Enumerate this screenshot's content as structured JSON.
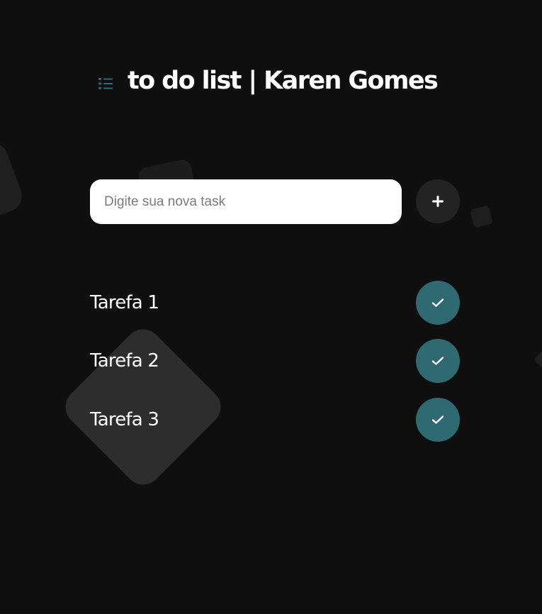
{
  "header": {
    "title": "to do list | Karen Gomes",
    "icon": "list-icon",
    "icon_color": "#2f6a73"
  },
  "new_task": {
    "placeholder": "Digite sua nova task",
    "value": "",
    "add_button_label": "+"
  },
  "tasks": [
    {
      "label": "Tarefa 1",
      "icon": "check-icon"
    },
    {
      "label": "Tarefa 2",
      "icon": "check-icon"
    },
    {
      "label": "Tarefa 3",
      "icon": "check-icon"
    }
  ],
  "colors": {
    "background": "#0f0f10",
    "accent": "#2f6a73",
    "add_button": "#232324",
    "text": "#ffffff"
  }
}
